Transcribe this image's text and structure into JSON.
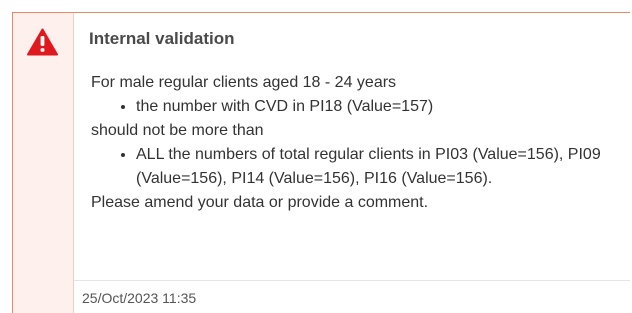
{
  "alert": {
    "icon": "warning-triangle-icon",
    "icon_color": "#e0191f",
    "border_color": "#e8896b",
    "title": "Internal validation",
    "message": {
      "intro": "For male regular clients aged 18 - 24 years",
      "first_items": [
        "the number with CVD in PI18 (Value=157)"
      ],
      "condition": "should not be more than",
      "second_items": [
        "ALL the numbers of total regular clients in PI03 (Value=156), PI09 (Value=156), PI14 (Value=156), PI16 (Value=156)."
      ],
      "instruction": "Please amend your data or provide a comment."
    },
    "timestamp": "25/Oct/2023 11:35"
  }
}
